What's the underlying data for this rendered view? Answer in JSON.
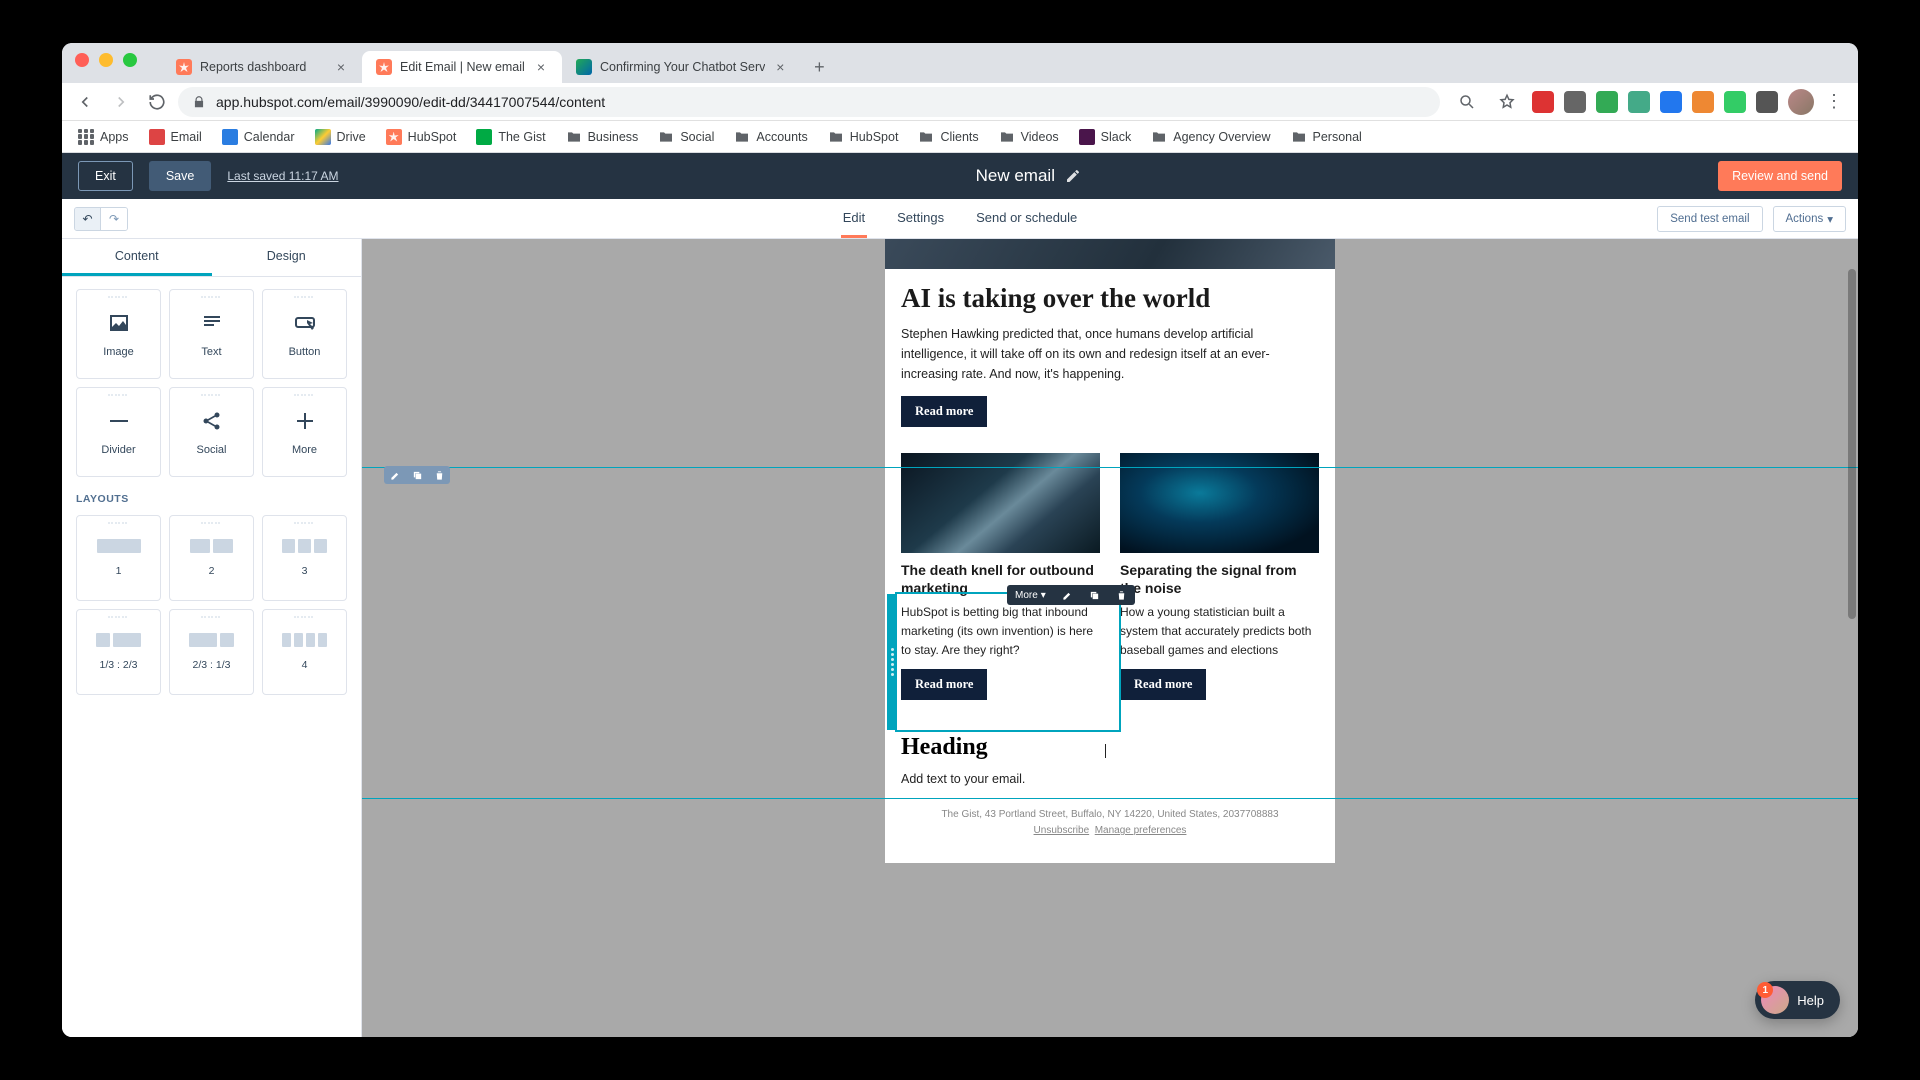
{
  "browser": {
    "tabs": [
      {
        "title": "Reports dashboard",
        "favicon": "hubspot"
      },
      {
        "title": "Edit Email | New email",
        "favicon": "hubspot",
        "active": true
      },
      {
        "title": "Confirming Your Chatbot Serv",
        "favicon": "generic"
      }
    ],
    "url": "app.hubspot.com/email/3990090/edit-dd/34417007544/content",
    "bookmarks": [
      "Apps",
      "Email",
      "Calendar",
      "Drive",
      "HubSpot",
      "The Gist",
      "Business",
      "Social",
      "Accounts",
      "HubSpot",
      "Clients",
      "Videos",
      "Slack",
      "Agency Overview",
      "Personal"
    ]
  },
  "hubspot": {
    "exit": "Exit",
    "save": "Save",
    "last_saved": "Last saved 11:17 AM",
    "title": "New email",
    "review": "Review and send",
    "tabs": {
      "edit": "Edit",
      "settings": "Settings",
      "send": "Send or schedule"
    },
    "send_test": "Send test email",
    "actions": "Actions"
  },
  "sidebar": {
    "tabs": {
      "content": "Content",
      "design": "Design"
    },
    "blocks": {
      "image": "Image",
      "text": "Text",
      "button": "Button",
      "divider": "Divider",
      "social": "Social",
      "more": "More"
    },
    "layouts_head": "LAYOUTS",
    "layouts": {
      "l1": "1",
      "l2": "2",
      "l3": "3",
      "l13": "1/3 : 2/3",
      "l23": "2/3 : 1/3",
      "l4": "4"
    }
  },
  "email": {
    "hero_h": "AI is taking over the world",
    "hero_p": "Stephen Hawking predicted that, once humans develop artificial intelligence, it will take off on its own and redesign itself at an ever-increasing rate. And now, it's happening.",
    "read_more": "Read more",
    "col1_h": "The death knell for outbound marketing",
    "col1_p": "HubSpot is betting big that inbound marketing (its own invention) is here to stay. Are they right?",
    "col2_h": "Separating the signal from the noise",
    "col2_p": "How a young statistician built a system that accurately predicts both baseball games and elections",
    "foot_h": "Heading",
    "foot_p": "Add text to your email.",
    "meta": "The Gist, 43 Portland Street, Buffalo, NY 14220, United States, 2037708883",
    "unsub": "Unsubscribe",
    "manage": "Manage preferences"
  },
  "module_toolbar": {
    "more": "More"
  },
  "help": {
    "label": "Help",
    "badge": "1"
  }
}
